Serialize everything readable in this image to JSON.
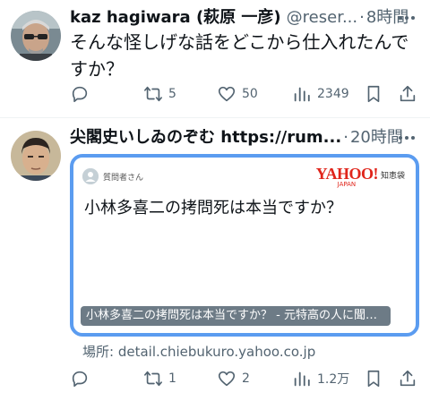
{
  "tweets": [
    {
      "name": "kaz hagiwara (萩原 一彦)",
      "handle": "@reser...",
      "dot": "·",
      "time": "8時間",
      "text": "そんな怪しげな話をどこから仕入れたんですか？",
      "replies": "",
      "retweets": "5",
      "likes": "50",
      "views": "2349"
    },
    {
      "name": "尖閣史いしゐのぞむ https://rum...",
      "dot": "·",
      "time": "20時間",
      "card": {
        "asker_label": "質問者さん",
        "logo_main": "YAHOO!",
        "logo_sub": "JAPAN",
        "logo_service": "知恵袋",
        "question": "小林多喜二の拷問死は本当ですか？",
        "caption": "小林多喜二の拷問死は本当ですか？ - 元特高の人に聞…"
      },
      "source": "場所: detail.chiebukuro.yahoo.co.jp",
      "replies": "",
      "retweets": "1",
      "likes": "2",
      "views": "1.2万"
    }
  ],
  "icons": {
    "reply": "reply-icon",
    "retweet": "retweet-icon",
    "like": "heart-icon",
    "views": "views-icon",
    "bookmark": "bookmark-icon",
    "share": "share-icon",
    "more": "more-icon"
  },
  "colors": {
    "text": "#0f1419",
    "secondary": "#536471",
    "card_border": "#5b9cf0",
    "logo": "#e0251b"
  }
}
